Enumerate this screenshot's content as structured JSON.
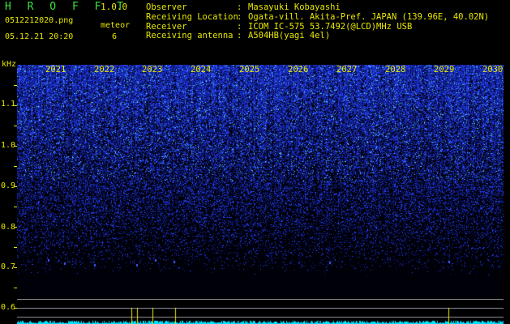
{
  "header": {
    "title": "H R O F F T",
    "version": "1.0.0",
    "filename": "0512212020.png",
    "meteor_label": "meteor",
    "datetime": "05.12.21 20:20",
    "meteor_count": "6"
  },
  "info": [
    {
      "key": "Observer",
      "sep": ":",
      "value": "Masayuki Kobayashi"
    },
    {
      "key": "Receiving Location",
      "sep": ":",
      "value": "Ogata-vill. Akita-Pref. JAPAN (139.96E, 40.02N)"
    },
    {
      "key": "Receiver",
      "sep": ":",
      "value": "ICOM IC-575 53.7492(@LCD)MHz USB"
    },
    {
      "key": "Receiving antenna",
      "sep": ":",
      "value": "A504HB(yagi 4el)"
    }
  ],
  "axis": {
    "unit": "kHz",
    "yticks": [
      "1.1",
      "1.0",
      "0.9",
      "0.8",
      "0.7",
      "0.6"
    ],
    "years": [
      "2021",
      "2022",
      "2023",
      "2024",
      "2025",
      "2026",
      "2027",
      "2028",
      "2029",
      "2030"
    ]
  },
  "colors": {
    "label": "#e8e800",
    "title": "#3fe03f",
    "background": "#000000",
    "spectrum": "#2a3cff",
    "trace": "#00e0ff"
  }
}
